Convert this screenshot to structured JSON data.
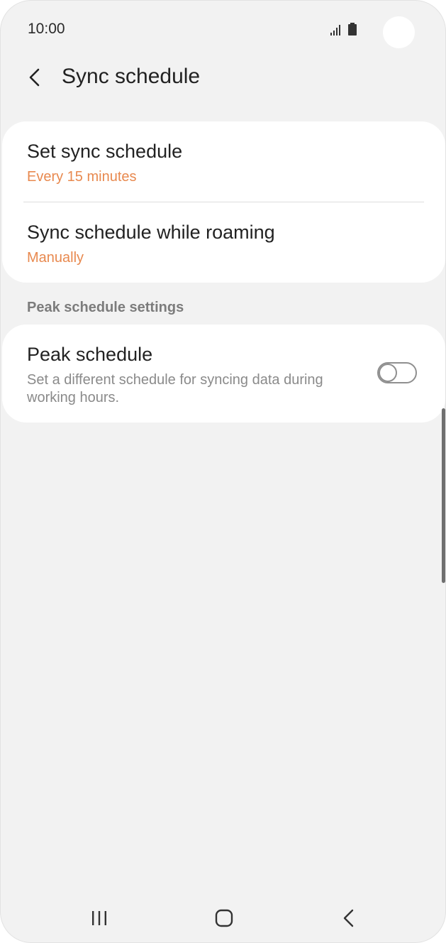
{
  "status_bar": {
    "time": "10:00",
    "icons": [
      "signal-icon",
      "battery-icon"
    ]
  },
  "header": {
    "title": "Sync schedule",
    "back_icon": "back-arrow-icon"
  },
  "sync_card": {
    "items": [
      {
        "title": "Set sync schedule",
        "value": "Every 15 minutes"
      },
      {
        "title": "Sync schedule while roaming",
        "value": "Manually"
      }
    ]
  },
  "peak_section": {
    "header": "Peak schedule settings",
    "item": {
      "title": "Peak schedule",
      "description": "Set a different schedule for syncing data during working hours.",
      "toggle_on": false
    }
  },
  "nav_bar": {
    "icons": [
      "recent-apps-icon",
      "home-icon",
      "back-icon"
    ]
  },
  "colors": {
    "background": "#f2f2f2",
    "card": "#ffffff",
    "accent": "#e8894f",
    "title_text": "#222222",
    "secondary_text": "#8a8a8a"
  }
}
